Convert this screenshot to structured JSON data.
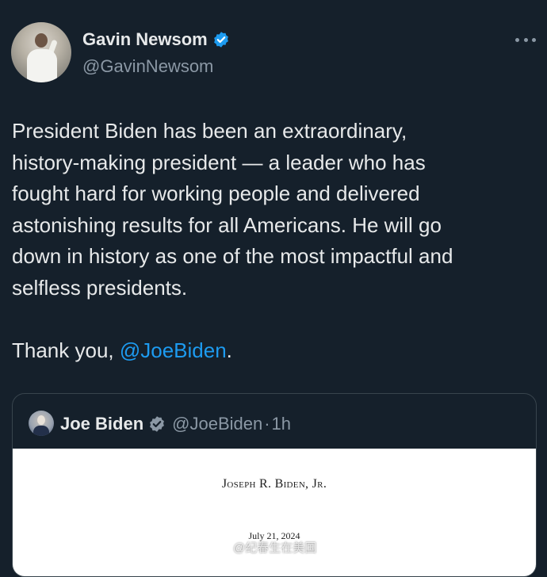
{
  "author": {
    "name": "Gavin Newsom",
    "handle": "@GavinNewsom",
    "verified_icon": "verified-badge-icon",
    "verified_color": "#1d9bf0"
  },
  "more_icon": "more-options-icon",
  "tweet": {
    "lines": [
      "President Biden has been an extraordinary,",
      "history-making president — a leader who has",
      "fought hard for working people and delivered",
      "astonishing results for all Americans. He will go",
      "down in history as one of the most impactful and",
      "selfless presidents."
    ],
    "closing_prefix": "Thank you, ",
    "closing_mention": "@JoeBiden",
    "closing_suffix": "."
  },
  "quoted": {
    "name": "Joe Biden",
    "handle": "@JoeBiden",
    "separator": "·",
    "time": "1h",
    "badge_icon": "verified-badge-icon",
    "letter": {
      "heading": "Joseph R. Biden, Jr.",
      "date": "July 21, 2024"
    }
  },
  "watermark": {
    "text": "@纪春生在美国"
  },
  "colors": {
    "background": "#15202b",
    "text": "#e7e9ea",
    "secondary": "#8b98a5",
    "accent": "#1d9bf0",
    "border": "#38444d"
  }
}
